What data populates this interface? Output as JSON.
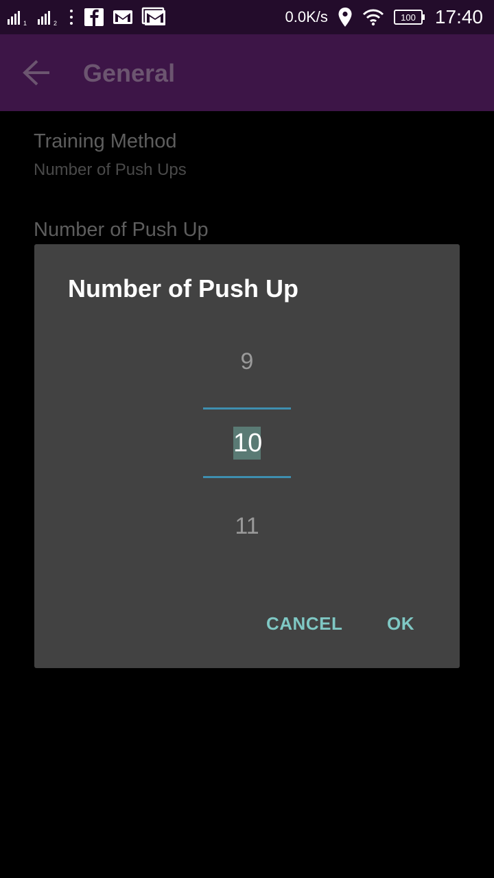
{
  "status_bar": {
    "sim1_label": "1",
    "sim2_label": "2",
    "net_speed": "0.0K/s",
    "battery": "100",
    "time": "17:40",
    "icons": [
      "signal-sim1-icon",
      "signal-sim2-icon",
      "more-vert-icon",
      "facebook-icon",
      "gmail-icon",
      "gmail-icon",
      "location-icon",
      "wifi-icon",
      "battery-icon"
    ]
  },
  "app_bar": {
    "title": "General",
    "back_icon": "arrow-back-icon"
  },
  "preferences": [
    {
      "title": "Training Method",
      "summary": "Number of Push Ups"
    },
    {
      "title": "Number of Push Up"
    }
  ],
  "dialog": {
    "title": "Number of Push Up",
    "picker": {
      "previous": "9",
      "current": "10",
      "next": "11"
    },
    "cancel_label": "CANCEL",
    "ok_label": "OK"
  },
  "colors": {
    "status_bar": "#230c2b",
    "app_bar": "#3d1547",
    "dialog_bg": "#424242",
    "accent": "#7fc8c4",
    "divider": "#3e8fb0",
    "selection": "#5a7a74"
  }
}
